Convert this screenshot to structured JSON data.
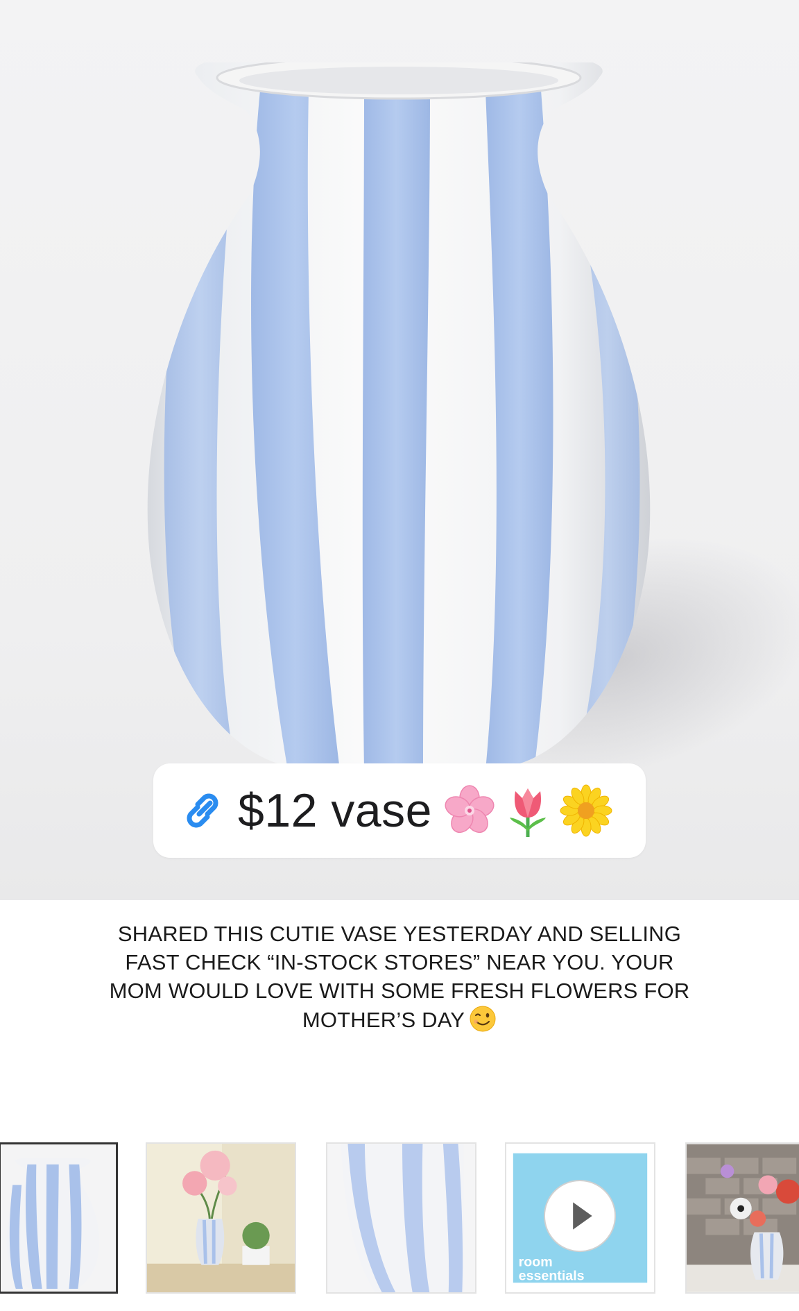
{
  "product": {
    "link_sticker": {
      "label": "$12 vase",
      "icon": "link-icon",
      "emojis": [
        "cherry-blossom-emoji",
        "tulip-emoji",
        "blossom-emoji"
      ]
    },
    "caption": "SHARED THIS CUTIE VASE YESTERDAY AND SELLING FAST CHECK “IN-STOCK STORES” NEAR YOU. YOUR MOM WOULD LOVE WITH SOME FRESH FLOWERS FOR MOTHER’S DAY",
    "caption_emoji": "winking-face-emoji"
  },
  "thumbnails": [
    {
      "name": "thumbnail-vase",
      "selected": true
    },
    {
      "name": "thumbnail-vase-with-flowers",
      "selected": false
    },
    {
      "name": "thumbnail-vase-closeup",
      "selected": false
    },
    {
      "name": "thumbnail-video",
      "selected": false,
      "brand_text": "room essentials",
      "icon": "play-icon"
    },
    {
      "name": "thumbnail-vase-bouquet",
      "selected": false
    }
  ],
  "colors": {
    "stripe_blue": "#a9c3ea",
    "link_blue": "#2a8cf0",
    "video_bg": "#8fd4ee"
  }
}
